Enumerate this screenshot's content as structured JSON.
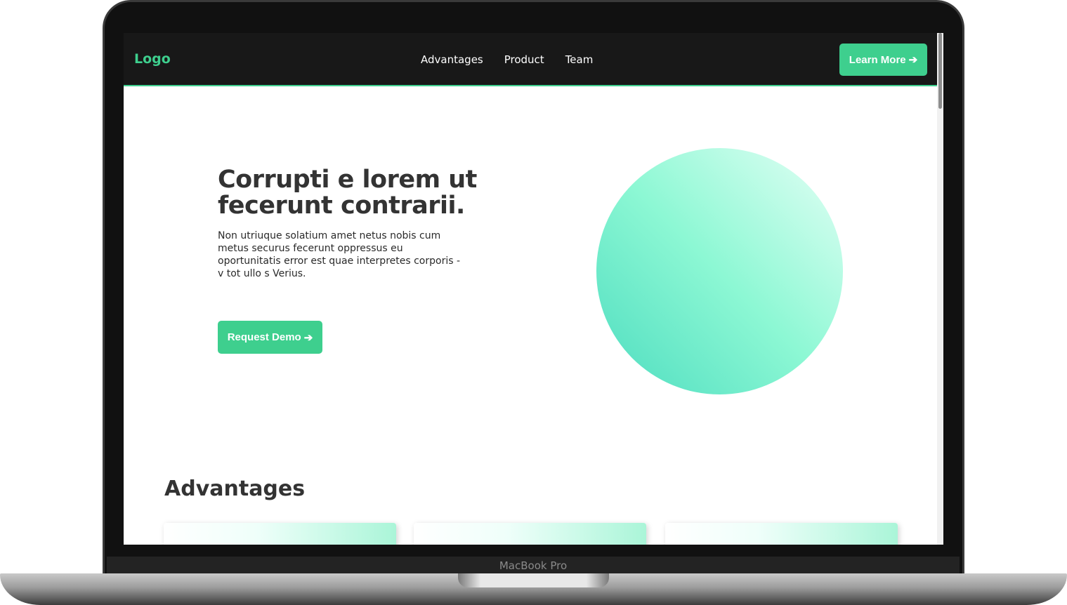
{
  "device": {
    "label": "MacBook Pro"
  },
  "navbar": {
    "logo": "Logo",
    "links": [
      "Advantages",
      "Product",
      "Team"
    ],
    "cta_label": "Learn More",
    "cta_arrow": "➔"
  },
  "hero": {
    "title": "Corrupti e lorem ut fecerunt contrarii.",
    "body": "Non utriuque solatium amet netus nobis cum metus securus fecerunt oppressus eu oportunitatis error est quae interpretes corporis - v tot ullo s Verius.",
    "button_label": "Request Demo",
    "button_arrow": "➔"
  },
  "advantages": {
    "title": "Advantages"
  },
  "colors": {
    "accent": "#3ecf8e",
    "navbar_bg": "#181818",
    "heading": "#333333"
  }
}
